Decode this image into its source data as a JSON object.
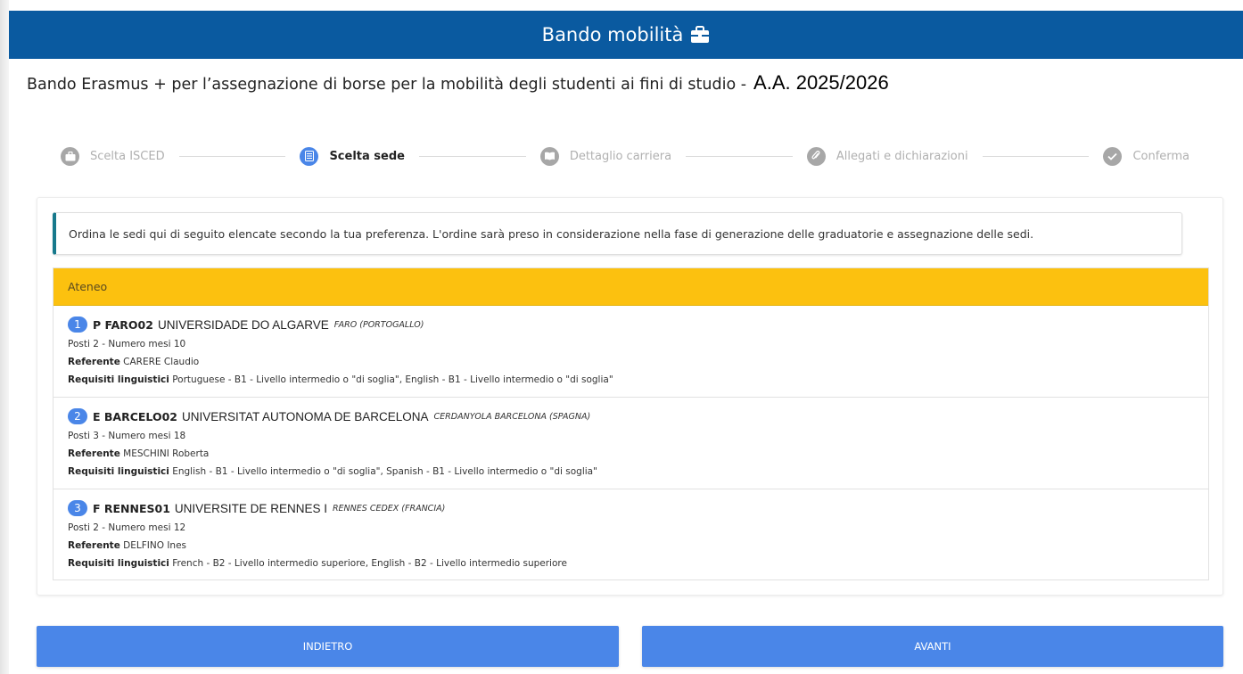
{
  "header": {
    "title": "Bando mobilità",
    "icon": "briefcase-icon",
    "bg": "#0a5aa0"
  },
  "page": {
    "title": "Bando Erasmus + per l’assegnazione di borse per la mobilità degli studenti ai fini di studio -",
    "year": "A.A. 2025/2026"
  },
  "stepper": {
    "steps": [
      {
        "label": "Scelta ISCED",
        "icon": "briefcase-icon",
        "active": false
      },
      {
        "label": "Scelta sede",
        "icon": "list-icon",
        "active": true
      },
      {
        "label": "Dettaglio carriera",
        "icon": "book-icon",
        "active": false
      },
      {
        "label": "Allegati e dichiarazioni",
        "icon": "paperclip-icon",
        "active": false
      },
      {
        "label": "Conferma",
        "icon": "check-icon",
        "active": false
      }
    ]
  },
  "notice": "Ordina le sedi qui di seguito elencate secondo la tua preferenza. L'ordine sarà preso in considerazione nella fase di generazione delle graduatorie e assegnazione delle sedi.",
  "list": {
    "header": "Ateneo",
    "header_color": "#fcc10f",
    "items": [
      {
        "rank": "1",
        "code": "P FARO02",
        "university": "UNIVERSIDADE DO ALGARVE",
        "city": "FARO (PORTOGALLO)",
        "posti": "Posti 2 - Numero mesi 10",
        "referente_label": "Referente",
        "referente": "CARERE Claudio",
        "requisiti_label": "Requisiti linguistici",
        "requisiti": "Portuguese - B1 - Livello intermedio o \"di soglia\", English - B1 - Livello intermedio o \"di soglia\""
      },
      {
        "rank": "2",
        "code": "E BARCELO02",
        "university": "UNIVERSITAT AUTONOMA DE BARCELONA",
        "city": "CERDANYOLA BARCELONA (SPAGNA)",
        "posti": "Posti 3 - Numero mesi 18",
        "referente_label": "Referente",
        "referente": "MESCHINI Roberta",
        "requisiti_label": "Requisiti linguistici",
        "requisiti": "English - B1 - Livello intermedio o \"di soglia\", Spanish - B1 - Livello intermedio o \"di soglia\""
      },
      {
        "rank": "3",
        "code": "F RENNES01",
        "university": "UNIVERSITE DE RENNES I",
        "city": "RENNES CEDEX (FRANCIA)",
        "posti": "Posti 2 - Numero mesi 12",
        "referente_label": "Referente",
        "referente": "DELFINO Ines",
        "requisiti_label": "Requisiti linguistici",
        "requisiti": "French - B2 - Livello intermedio superiore, English - B2 - Livello intermedio superiore"
      }
    ]
  },
  "buttons": {
    "back": "INDIETRO",
    "next": "AVANTI",
    "color": "#4a86e8"
  }
}
